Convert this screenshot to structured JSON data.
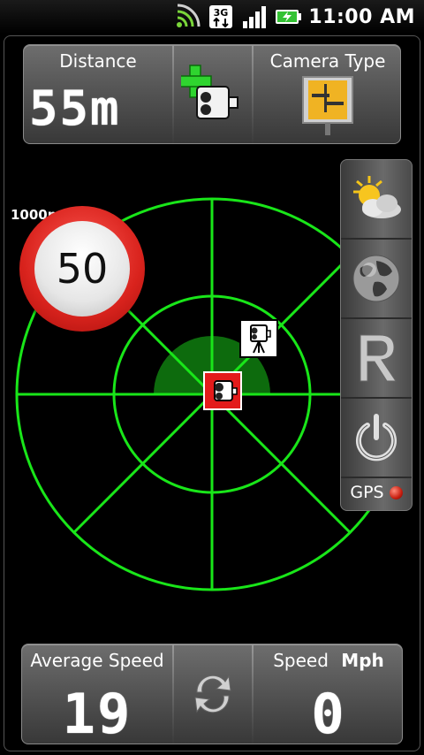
{
  "status_bar": {
    "time": "11:00 AM",
    "network_type": "3G",
    "icons": [
      "wifi-icon",
      "network-3g-icon",
      "signal-icon",
      "battery-charging-icon"
    ]
  },
  "top_panel": {
    "distance_label": "Distance",
    "distance_value": "55m",
    "add_camera_icon": "add-camera-icon",
    "camera_type_label": "Camera Type",
    "camera_type_icon": "traffic-sign-icon"
  },
  "radar": {
    "range_label": "1000m",
    "speed_limit": "50",
    "accent_color": "#19e619",
    "arc_color": "#0f6a0f"
  },
  "side_menu": {
    "buttons": [
      {
        "name": "weather",
        "icon": "weather-icon"
      },
      {
        "name": "globe",
        "icon": "globe-icon"
      },
      {
        "name": "radar-logo",
        "icon": "r-logo-icon"
      },
      {
        "name": "power",
        "icon": "power-icon"
      }
    ],
    "gps_label": "GPS",
    "gps_status_color": "#c81e0f"
  },
  "bottom_panel": {
    "average_speed_label": "Average Speed",
    "average_speed_value": "19",
    "refresh_icon": "refresh-icon",
    "speed_label": "Speed",
    "speed_unit": "Mph",
    "speed_value": "0"
  }
}
